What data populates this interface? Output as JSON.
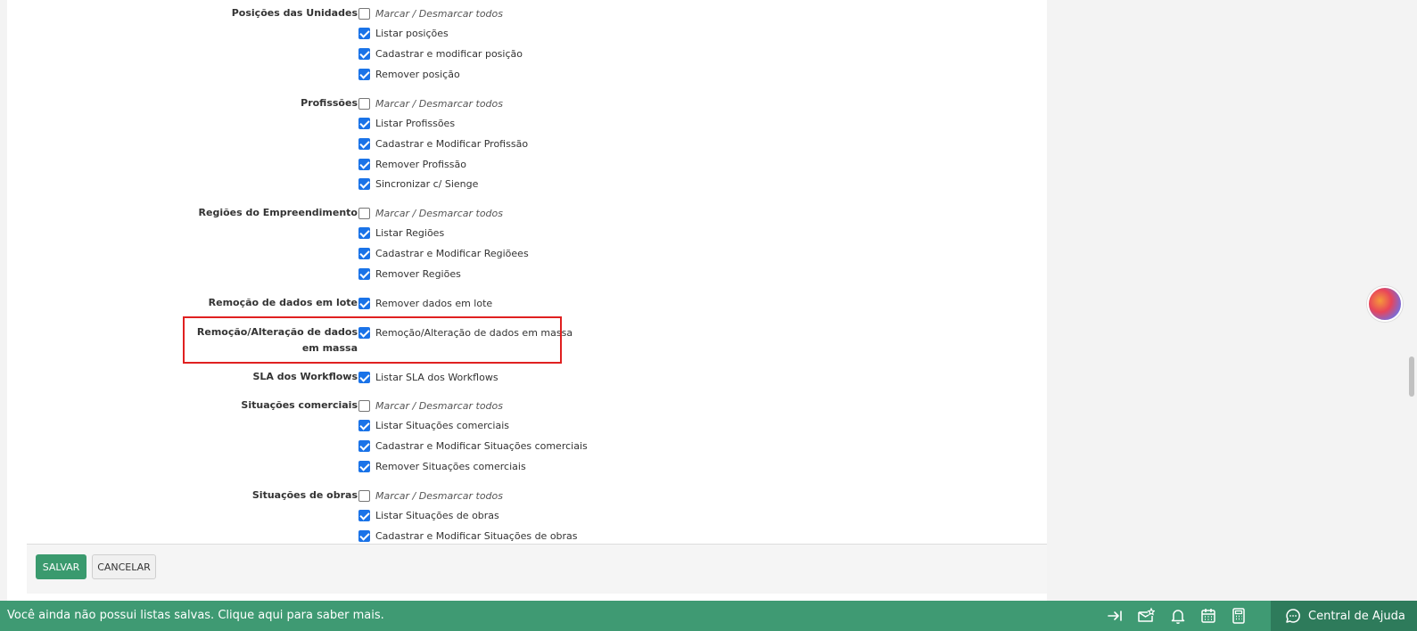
{
  "groups": [
    {
      "label": "Posições das Unidades",
      "options": [
        {
          "label": "Marcar / Desmarcar todos",
          "checked": false,
          "italic": true
        },
        {
          "label": "Listar posições",
          "checked": true
        },
        {
          "label": "Cadastrar e modificar posição",
          "checked": true
        },
        {
          "label": "Remover posição",
          "checked": true
        }
      ]
    },
    {
      "label": "Profissões",
      "options": [
        {
          "label": "Marcar / Desmarcar todos",
          "checked": false,
          "italic": true
        },
        {
          "label": "Listar Profissões",
          "checked": true
        },
        {
          "label": "Cadastrar e Modificar Profissão",
          "checked": true
        },
        {
          "label": "Remover Profissão",
          "checked": true
        },
        {
          "label": "Sincronizar c/ Sienge",
          "checked": true
        }
      ]
    },
    {
      "label": "Regiões do Empreendimento",
      "options": [
        {
          "label": "Marcar / Desmarcar todos",
          "checked": false,
          "italic": true
        },
        {
          "label": "Listar Regiões",
          "checked": true
        },
        {
          "label": "Cadastrar e Modificar Regiõees",
          "checked": true
        },
        {
          "label": "Remover Regiões",
          "checked": true
        }
      ]
    },
    {
      "label": "Remoção de dados em lote",
      "options": [
        {
          "label": "Remover dados em lote",
          "checked": true
        }
      ]
    },
    {
      "label": "Remoção/Alteração de dados em massa",
      "label_line1": "Remoção/Alteração de dados",
      "label_line2": "em massa",
      "options": [
        {
          "label": "Remoção/Alteração de dados em massa",
          "checked": true
        }
      ]
    },
    {
      "label": "SLA dos Workflows",
      "options": [
        {
          "label": "Listar SLA dos Workflows",
          "checked": true
        }
      ]
    },
    {
      "label": "Situações comerciais",
      "options": [
        {
          "label": "Marcar / Desmarcar todos",
          "checked": false,
          "italic": true
        },
        {
          "label": "Listar Situações comerciais",
          "checked": true
        },
        {
          "label": "Cadastrar e Modificar Situações comerciais",
          "checked": true
        },
        {
          "label": "Remover Situações comerciais",
          "checked": true
        }
      ]
    },
    {
      "label": "Situações de obras",
      "options": [
        {
          "label": "Marcar / Desmarcar todos",
          "checked": false,
          "italic": true
        },
        {
          "label": "Listar Situações de obras",
          "checked": true
        },
        {
          "label": "Cadastrar e Modificar Situações de obras",
          "checked": true
        }
      ]
    }
  ],
  "footer": {
    "save_label": "SALVAR",
    "cancel_label": "CANCELAR"
  },
  "bottom_bar": {
    "message": "Você ainda não possui listas salvas. Clique aqui para saber mais.",
    "help_label": "Central de Ajuda",
    "icons": [
      "collapse-arrow-icon",
      "mail-star-icon",
      "bell-icon",
      "calendar-icon",
      "calculator-icon"
    ]
  },
  "colors": {
    "accent": "#3f9a73",
    "checkbox": "#1a73e8",
    "highlight": "#e02020"
  }
}
